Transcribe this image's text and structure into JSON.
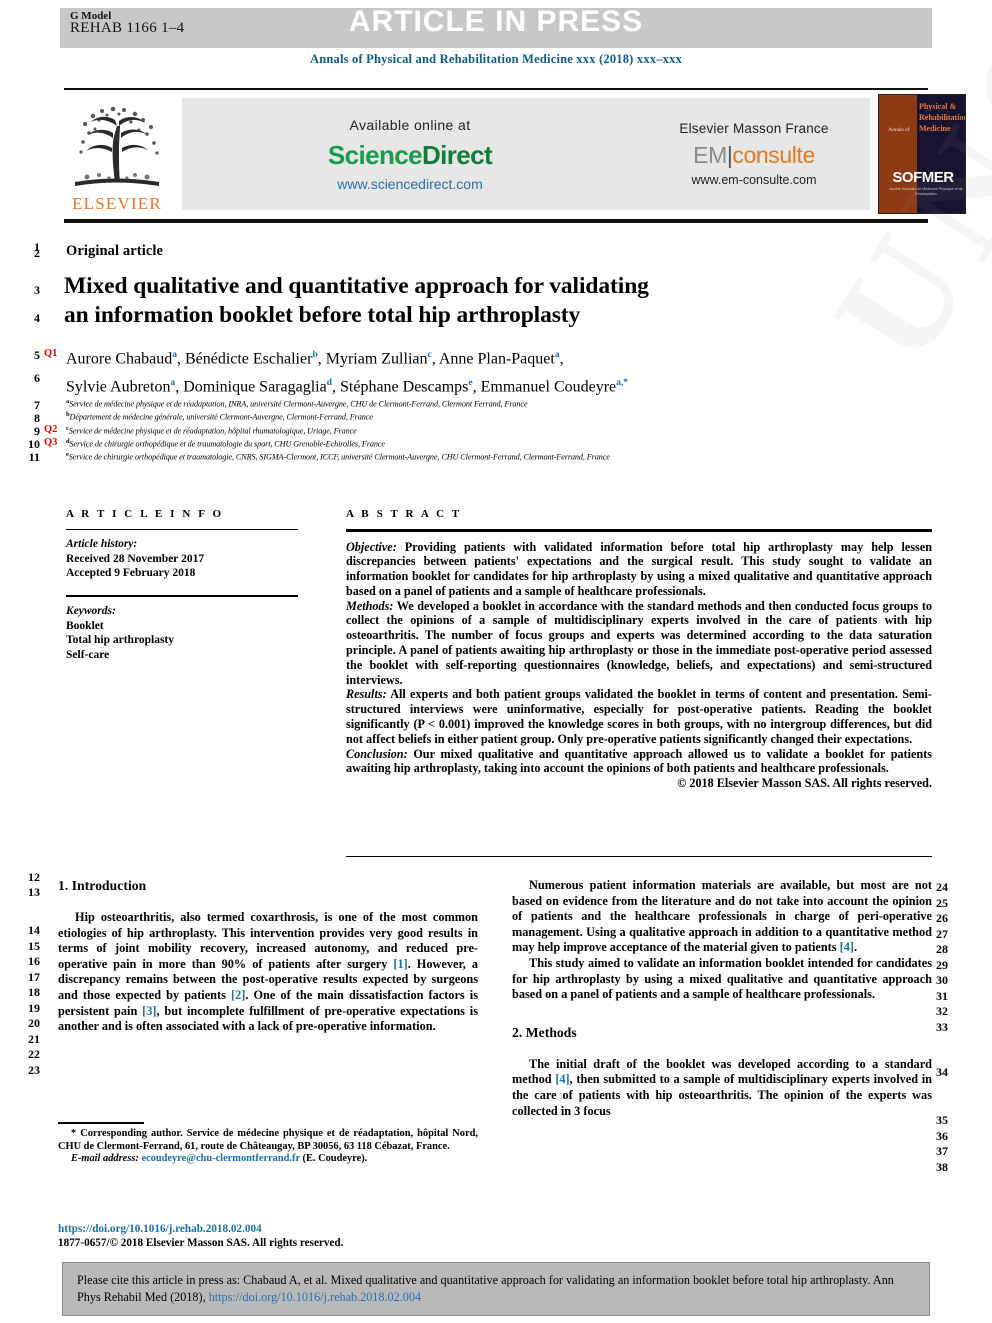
{
  "header": {
    "g_model_label": "G Model",
    "g_model_id": "REHAB 1166 1–4",
    "article_in_press": "ARTICLE IN PRESS",
    "journal_line": "Annals of Physical and Rehabilitation Medicine xxx (2018) xxx–xxx"
  },
  "masthead": {
    "elsevier_wordmark": "ELSEVIER",
    "available_online_at": "Available online at",
    "sciencedirect_part1": "Science",
    "sciencedirect_part2": "Direct",
    "sciencedirect_url": "www.sciencedirect.com",
    "em_title": "Elsevier Masson France",
    "em_logo_em": "EM",
    "em_logo_bar": "|",
    "em_logo_consulte": "consulte",
    "em_url": "www.em-consulte.com",
    "sofmer_annals": "Annals of",
    "sofmer_line1": "Physical &",
    "sofmer_line2": "Rehabilitation",
    "sofmer_line3": "Medicine",
    "sofmer_brand": "SOFMER",
    "sofmer_sub": "société française de Médecine Physique et de Réadaptation"
  },
  "line_numbers": [
    "1",
    "2",
    "3",
    "4",
    "5",
    "6",
    "7",
    "8",
    "9",
    "10",
    "11",
    "12",
    "13",
    "14",
    "15",
    "16",
    "17",
    "18",
    "19",
    "20",
    "21",
    "22",
    "23",
    "24",
    "25",
    "26",
    "27",
    "28",
    "29",
    "30",
    "31",
    "32",
    "33",
    "34",
    "35",
    "36",
    "37",
    "38"
  ],
  "query_tags": [
    "Q1",
    "Q2",
    "Q3"
  ],
  "article": {
    "section_type": "Original article",
    "title_line1": "Mixed qualitative and quantitative approach for validating",
    "title_line2": "an information booklet before total hip arthroplasty",
    "authors_line1_pre": "Aurore Chabaud",
    "authors_line1": "Aurore Chabaud a, Bénédicte Eschalier b, Myriam Zullian c, Anne Plan-Paquet a,",
    "authors_line2": "Sylvie Aubreton a, Dominique Saragaglia d, Stéphane Descamps e, Emmanuel Coudeyre a,*",
    "affiliations": [
      {
        "sup": "a",
        "text": "Service de médecine physique et de réadaptation, INRA, université Clermont-Auvergne, CHU de Clermont-Ferrand, Clermont Ferrand, France"
      },
      {
        "sup": "b",
        "text": "Département de médecine générale, université Clermont-Auvergne, Clermont-Ferrand, France"
      },
      {
        "sup": "c",
        "text": "Service de médecine physique et de réadaptation, hôpital rhumatologique, Uriage, France"
      },
      {
        "sup": "d",
        "text": "Service de chirurgie orthopédique et de traumatologie du sport, CHU Grenoble-Echirolles, France"
      },
      {
        "sup": "e",
        "text": "Service de chirurgie orthopédique et traumatologie, CNRS, SIGMA-Clermont, ICCF, université Clermont-Auvergne, CHU Clermont-Ferrand, Clermont-Ferrand, France"
      }
    ]
  },
  "article_info": {
    "heading": "A R T I C L E  I N F O",
    "history_label": "Article history:",
    "received": "Received 28 November 2017",
    "accepted": "Accepted 9 February 2018",
    "keywords_label": "Keywords:",
    "keywords": [
      "Booklet",
      "Total hip arthroplasty",
      "Self-care"
    ]
  },
  "abstract": {
    "heading": "A B S T R A C T",
    "objective_label": "Objective:",
    "objective_text": " Providing patients with validated information before total hip arthroplasty may help lessen discrepancies between patients' expectations and the surgical result. This study sought to validate an information booklet for candidates for hip arthroplasty by using a mixed qualitative and quantitative approach based on a panel of patients and a sample of healthcare professionals.",
    "methods_label": "Methods:",
    "methods_text": " We developed a booklet in accordance with the standard methods and then conducted focus groups to collect the opinions of a sample of multidisciplinary experts involved in the care of patients with hip osteoarthritis. The number of focus groups and experts was determined according to the data saturation principle. A panel of patients awaiting hip arthroplasty or those in the immediate post-operative period assessed the booklet with self-reporting questionnaires (knowledge, beliefs, and expectations) and semi-structured interviews.",
    "results_label": "Results:",
    "results_text": " All experts and both patient groups validated the booklet in terms of content and presentation. Semi-structured interviews were uninformative, especially for post-operative patients. Reading the booklet significantly (P < 0.001) improved the knowledge scores in both groups, with no intergroup differences, but did not affect beliefs in either patient group. Only pre-operative patients significantly changed their expectations.",
    "conclusion_label": "Conclusion:",
    "conclusion_text": " Our mixed qualitative and quantitative approach allowed us to validate a booklet for patients awaiting hip arthroplasty, taking into account the opinions of both patients and healthcare professionals.",
    "copyright": "© 2018 Elsevier Masson SAS. All rights reserved."
  },
  "body": {
    "intro_heading": "1. Introduction",
    "intro_p1_a": "Hip osteoarthritis, also termed coxarthrosis, is one of the most common etiologies of hip arthroplasty. This intervention provides very good results in terms of joint mobility recovery, increased autonomy, and reduced pre-operative pain in more than 90% of patients after surgery ",
    "ref1": "[1]",
    "intro_p1_b": ". However, a discrepancy remains between the post-operative results expected by surgeons and those expected by patients ",
    "ref2": "[2]",
    "intro_p1_c": ". One of the main dissatisfaction factors is persistent pain ",
    "ref3": "[3]",
    "intro_p1_d": ", but incomplete fulfillment of pre-operative expectations is another and is often associated with a lack of pre-operative information.",
    "right_p1_a": "Numerous patient information materials are available, but most are not based on evidence from the literature and do not take into account the opinion of patients and the healthcare professionals in charge of peri-operative management. Using a qualitative approach in addition to a quantitative method may help improve acceptance of the material given to patients ",
    "ref4": "[4]",
    "right_p1_b": ".",
    "right_p2": "This study aimed to validate an information booklet intended for candidates for hip arthroplasty by using a mixed qualitative and quantitative approach based on a panel of patients and a sample of healthcare professionals.",
    "methods_heading": "2. Methods",
    "methods_p1_a": "The initial draft of the booklet was developed according to a standard method ",
    "ref4b": "[4]",
    "methods_p1_b": ", then submitted to a sample of multidisciplinary experts involved in the care of patients with hip osteoarthritis. The opinion of the experts was collected in 3 focus"
  },
  "footnote": {
    "star": "*",
    "corresponding": " Corresponding author. Service de médecine physique et de réadaptation, hôpital Nord, CHU de Clermont-Ferrand, 61, route de Châteaugay, BP 30056, 63 118 Cébazat, France.",
    "email_label": "E-mail address:",
    "email": "ecoudeyre@chu-clermontferrand.fr",
    "email_owner": " (E. Coudeyre).",
    "doi": "https://doi.org/10.1016/j.rehab.2018.02.004",
    "issn_line": "1877-0657/© 2018 Elsevier Masson SAS. All rights reserved."
  },
  "cite_footer": {
    "text_a": "Please cite this article in press as: Chabaud A, et al. Mixed qualitative and quantitative approach for validating an information booklet before total hip arthroplasty. Ann Phys Rehabil Med (2018), ",
    "doi": "https://doi.org/10.1016/j.rehab.2018.02.004"
  },
  "watermark": {
    "line": "UNCORRECTED PROOF"
  },
  "colors": {
    "journal_blue": "#0f5c8c",
    "link_blue": "#1a6fa8",
    "query_red": "#e00000",
    "elsevier_orange": "#E87722",
    "sciencedirect_green": "#1a9b4c",
    "header_gray": "#c8c8c8",
    "panel_gray": "#e7e7e7",
    "footer_gray": "#b9b9b9"
  }
}
